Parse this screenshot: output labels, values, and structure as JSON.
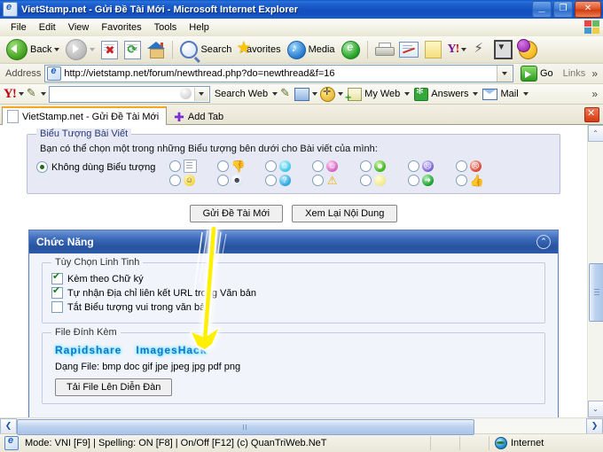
{
  "window": {
    "title": "VietStamp.net - Gửi Đề Tài Mới - Microsoft Internet Explorer",
    "minimize_label": "_",
    "maximize_label": "❐",
    "close_label": "✕"
  },
  "menu": {
    "items": [
      "File",
      "Edit",
      "View",
      "Favorites",
      "Tools",
      "Help"
    ]
  },
  "toolbar": {
    "back_label": "Back",
    "search_label": "Search",
    "favorites_label": "Favorites",
    "media_label": "Media"
  },
  "address": {
    "label": "Address",
    "url": "http://vietstamp.net/forum/newthread.php?do=newthread&f=16",
    "go_label": "Go",
    "links_label": "Links",
    "more_label": "»"
  },
  "yahoo_toolbar": {
    "logo": "Y!",
    "search_value": "",
    "search_web_label": "Search Web",
    "my_web_label": "My Web",
    "answers_label": "Answers",
    "mail_label": "Mail",
    "overflow_label": "»"
  },
  "tabs": {
    "items": [
      {
        "label": "VietStamp.net - Gửi Đề Tài Mới",
        "active": true
      }
    ],
    "add_tab_label": "Add Tab",
    "close_label": "✕"
  },
  "forum": {
    "icon_section": {
      "legend": "Biểu Tượng Bài Viết",
      "hint": "Bạn có thể chọn một trong những Biểu tượng bên dưới cho Bài viết của mình:",
      "no_icon_label": "Không dùng Biểu tượng",
      "no_icon_selected": true,
      "icons_row1": [
        {
          "name": "document-icon",
          "glyph": ""
        },
        {
          "name": "thumbs-down-icon",
          "glyph": "👎"
        },
        {
          "name": "cyan-smiley-icon",
          "glyph": "☺"
        },
        {
          "name": "pink-smiley-icon",
          "glyph": "☺"
        },
        {
          "name": "green-grin-icon",
          "glyph": "☻"
        },
        {
          "name": "purple-sad-icon",
          "glyph": "☹"
        },
        {
          "name": "red-angry-icon",
          "glyph": "☹"
        }
      ],
      "icons_row2": [
        {
          "name": "yellow-smiley-icon",
          "glyph": "☺"
        },
        {
          "name": "sunglasses-smiley-icon",
          "glyph": "☻"
        },
        {
          "name": "blue-question-icon",
          "glyph": "?"
        },
        {
          "name": "warning-triangle-icon",
          "glyph": "⚠"
        },
        {
          "name": "lightbulb-icon",
          "glyph": ""
        },
        {
          "name": "green-arrow-icon",
          "glyph": "➜"
        },
        {
          "name": "thumbs-up-icon",
          "glyph": "👍"
        }
      ]
    },
    "buttons": {
      "submit_label": "Gửi Đề Tài Mới",
      "preview_label": "Xem Lại Nội Dung"
    },
    "panel": {
      "title": "Chức Năng",
      "collapse_icon": "⌃",
      "options": {
        "legend": "Tùy Chọn Linh Tinh",
        "items": [
          {
            "label": "Kèm theo Chữ ký",
            "checked": true
          },
          {
            "label": "Tự nhận Địa chỉ liên kết URL trong Văn bản",
            "checked": true
          },
          {
            "label": "Tắt Biểu tượng vui trong văn bản",
            "checked": false
          }
        ]
      },
      "attachments": {
        "legend": "File Đính Kèm",
        "links": [
          "Rapidshare",
          "ImagesHack"
        ],
        "filetypes": "Dạng File: bmp doc gif jpe jpeg jpg pdf png",
        "upload_label": "Tải File Lên Diễn Đàn"
      }
    }
  },
  "statusbar": {
    "message": "Mode: VNI [F9] | Spelling: ON [F8] | On/Off [F12] (c) QuanTriWeb.NeT",
    "zone": "Internet"
  },
  "scrollbars": {
    "up_arrow": "⌃",
    "down_arrow": "⌄",
    "left_arrow": "❮",
    "right_arrow": "❯"
  },
  "colors": {
    "titlebar_blue": "#1550bf",
    "panel_header_blue": "#3d6bbb",
    "fieldset_bg": "#e7e9f4",
    "annotation_yellow": "#ffee00",
    "link_cyan": "#1673c8"
  }
}
